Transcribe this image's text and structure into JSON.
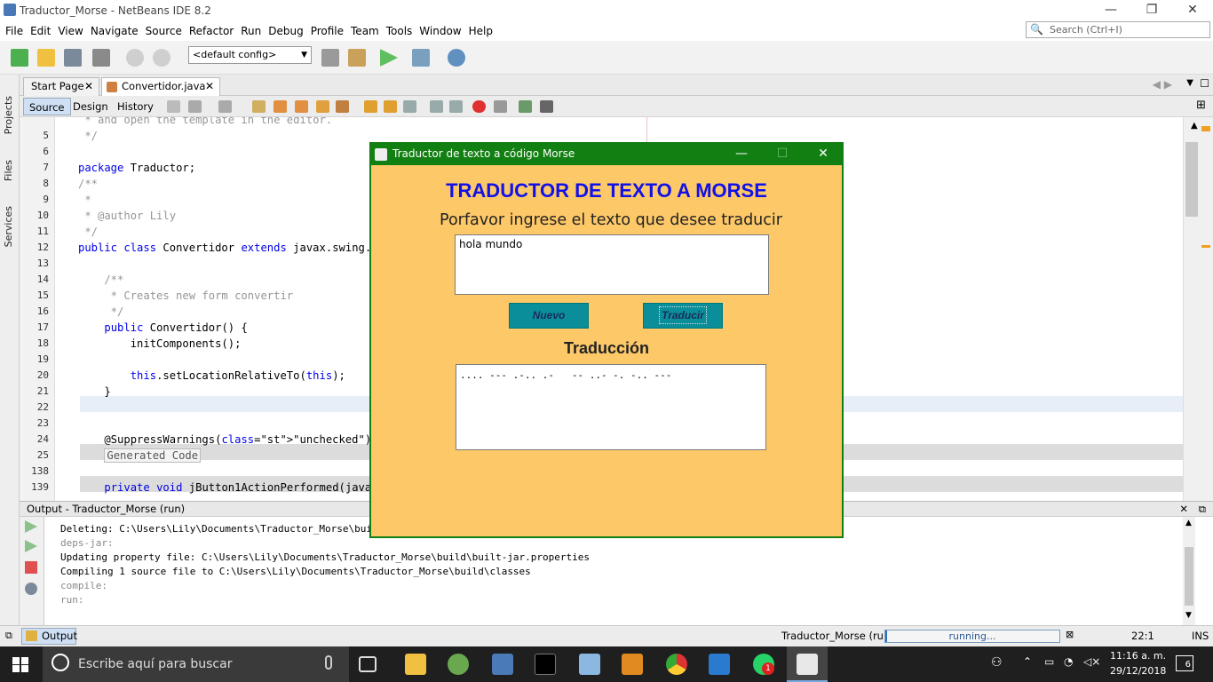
{
  "window": {
    "title": "Traductor_Morse - NetBeans IDE 8.2"
  },
  "menu": [
    "File",
    "Edit",
    "View",
    "Navigate",
    "Source",
    "Refactor",
    "Run",
    "Debug",
    "Profile",
    "Team",
    "Tools",
    "Window",
    "Help"
  ],
  "search": {
    "placeholder": "Search (Ctrl+I)"
  },
  "toolbar": {
    "config": "<default config>"
  },
  "side_tabs": [
    "Projects",
    "Files",
    "Services"
  ],
  "editor_tabs": [
    {
      "label": "Start Page"
    },
    {
      "label": "Convertidor.java"
    }
  ],
  "editor_views": [
    "Source",
    "Design",
    "History"
  ],
  "code_lines": [
    {
      "n": "",
      "text": " * and open the template in the editor."
    },
    {
      "n": "5",
      "text": " */"
    },
    {
      "n": "6",
      "text": ""
    },
    {
      "n": "7",
      "text": "package Traductor;"
    },
    {
      "n": "8",
      "text": "/**"
    },
    {
      "n": "9",
      "text": " *"
    },
    {
      "n": "10",
      "text": " * @author Lily"
    },
    {
      "n": "11",
      "text": " */"
    },
    {
      "n": "12",
      "text": "public class Convertidor extends javax.swing.JFrame {"
    },
    {
      "n": "13",
      "text": ""
    },
    {
      "n": "14",
      "text": "    /**"
    },
    {
      "n": "15",
      "text": "     * Creates new form convertir"
    },
    {
      "n": "16",
      "text": "     */"
    },
    {
      "n": "17",
      "text": "    public Convertidor() {"
    },
    {
      "n": "18",
      "text": "        initComponents();"
    },
    {
      "n": "19",
      "text": ""
    },
    {
      "n": "20",
      "text": "        this.setLocationRelativeTo(this);"
    },
    {
      "n": "21",
      "text": "    }"
    },
    {
      "n": "22",
      "text": ""
    },
    {
      "n": "23",
      "text": ""
    },
    {
      "n": "24",
      "text": "    @SuppressWarnings(\"unchecked\")"
    },
    {
      "n": "25",
      "text": "    Generated Code"
    },
    {
      "n": "138",
      "text": ""
    },
    {
      "n": "139",
      "text": "    private void jButton1ActionPerformed(java.awt.event.ActionEvent evt) {"
    }
  ],
  "output": {
    "title": "Output - Traductor_Morse (run)",
    "lines": [
      {
        "t": "Deleting: C:\\Users\\Lily\\Documents\\Traductor_Morse\\build\\built-jar.properties",
        "g": false
      },
      {
        "t": "deps-jar:",
        "g": true
      },
      {
        "t": "Updating property file: C:\\Users\\Lily\\Documents\\Traductor_Morse\\build\\built-jar.properties",
        "g": false
      },
      {
        "t": "Compiling 1 source file to C:\\Users\\Lily\\Documents\\Traductor_Morse\\build\\classes",
        "g": false
      },
      {
        "t": "compile:",
        "g": true
      },
      {
        "t": "run:",
        "g": true
      }
    ]
  },
  "status": {
    "output_tab": "Output",
    "project": "Traductor_Morse (run)",
    "progress": "running...",
    "position": "22:1",
    "mode": "INS"
  },
  "dialog": {
    "title": "Traductor de texto a código Morse",
    "heading": "TRADUCTOR DE TEXTO A MORSE",
    "prompt": "Porfavor ingrese el texto que desee traducir",
    "input_value": "hola mundo",
    "btn_new": "Nuevo",
    "btn_translate": "Traducir",
    "result_label": "Traducción",
    "result_value": ".... --- .-.. .-   -- ..- -. -.. ---"
  },
  "taskbar": {
    "search_placeholder": "Escribe aquí para buscar",
    "time": "11:16 a. m.",
    "date": "29/12/2018",
    "notifications": "6"
  }
}
